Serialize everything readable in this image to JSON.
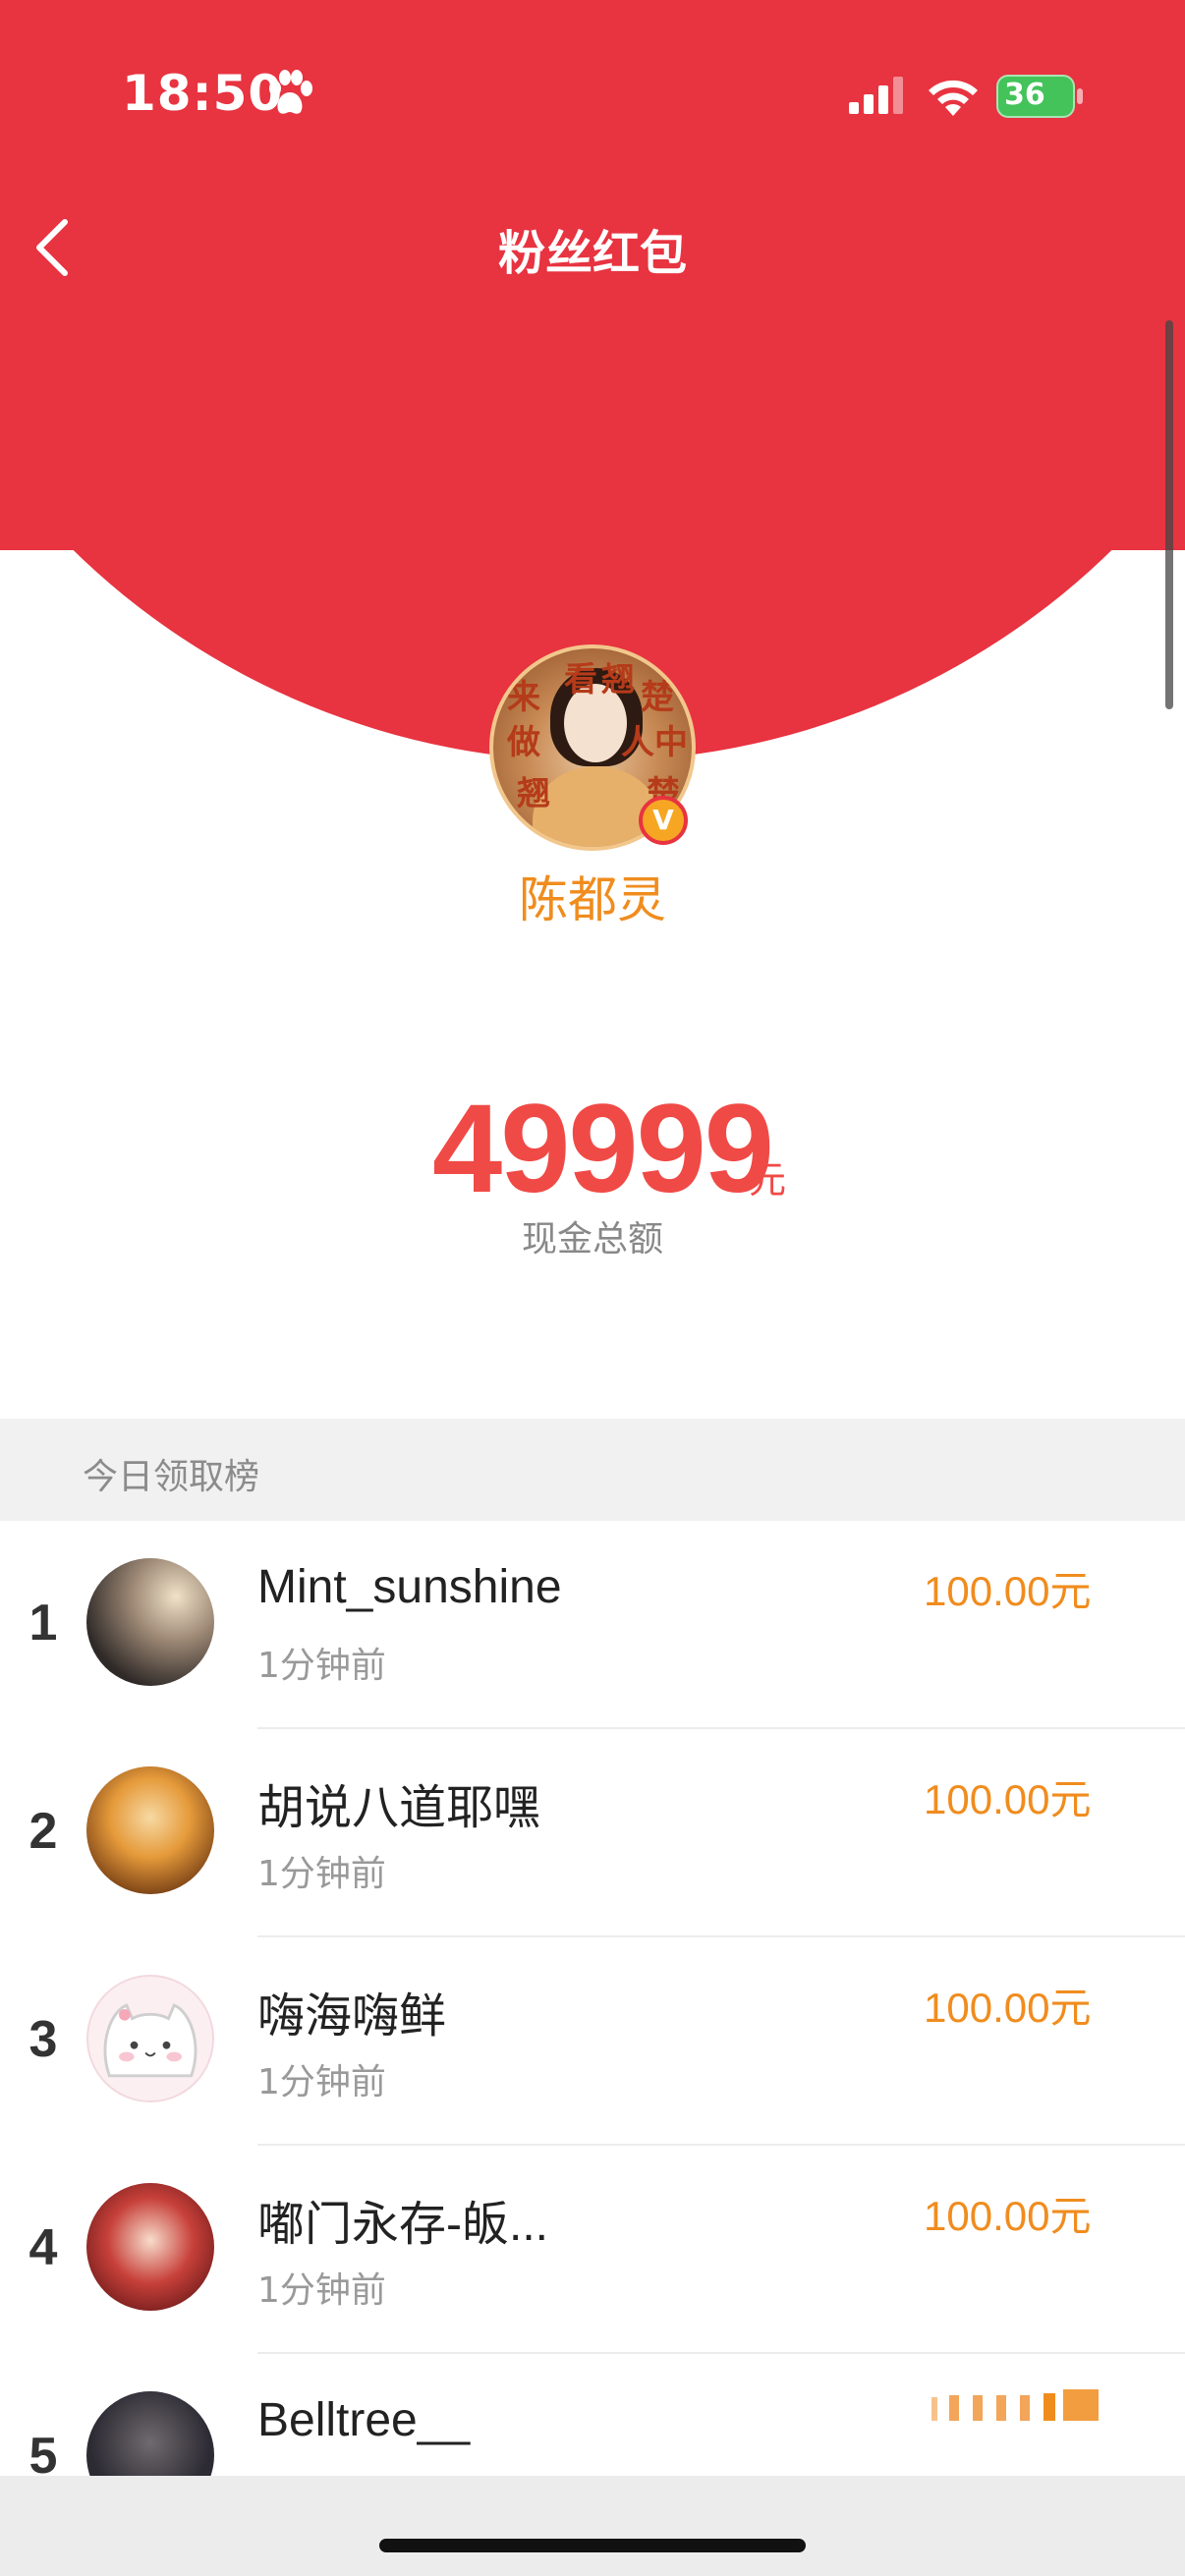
{
  "status_bar": {
    "time": "18:50",
    "battery": "36"
  },
  "nav": {
    "title": "粉丝红包"
  },
  "profile": {
    "name": "陈都灵",
    "verified_badge": "V",
    "avatar_text": [
      "来",
      "看",
      "翘",
      "楚",
      "做",
      "人",
      "中",
      "翘",
      "楚"
    ]
  },
  "amount": {
    "value": "49999",
    "unit": "元",
    "label": "现金总额"
  },
  "leaderboard": {
    "title": "今日领取榜",
    "rows": [
      {
        "rank": "1",
        "name": "Mint_sunshine",
        "time": "1分钟前",
        "amount": "100.00元"
      },
      {
        "rank": "2",
        "name": "胡说八道耶嘿",
        "time": "1分钟前",
        "amount": "100.00元"
      },
      {
        "rank": "3",
        "name": "嗨海嗨鲜",
        "time": "1分钟前",
        "amount": "100.00元"
      },
      {
        "rank": "4",
        "name": "嘟门永存-皈...",
        "time": "1分钟前",
        "amount": "100.00元"
      },
      {
        "rank": "5",
        "name": "Belltree__",
        "time": "",
        "amount": ""
      }
    ]
  },
  "colors": {
    "header_red": "#e83340",
    "accent_orange": "#f08c1e",
    "amount_red": "#f04a46"
  }
}
